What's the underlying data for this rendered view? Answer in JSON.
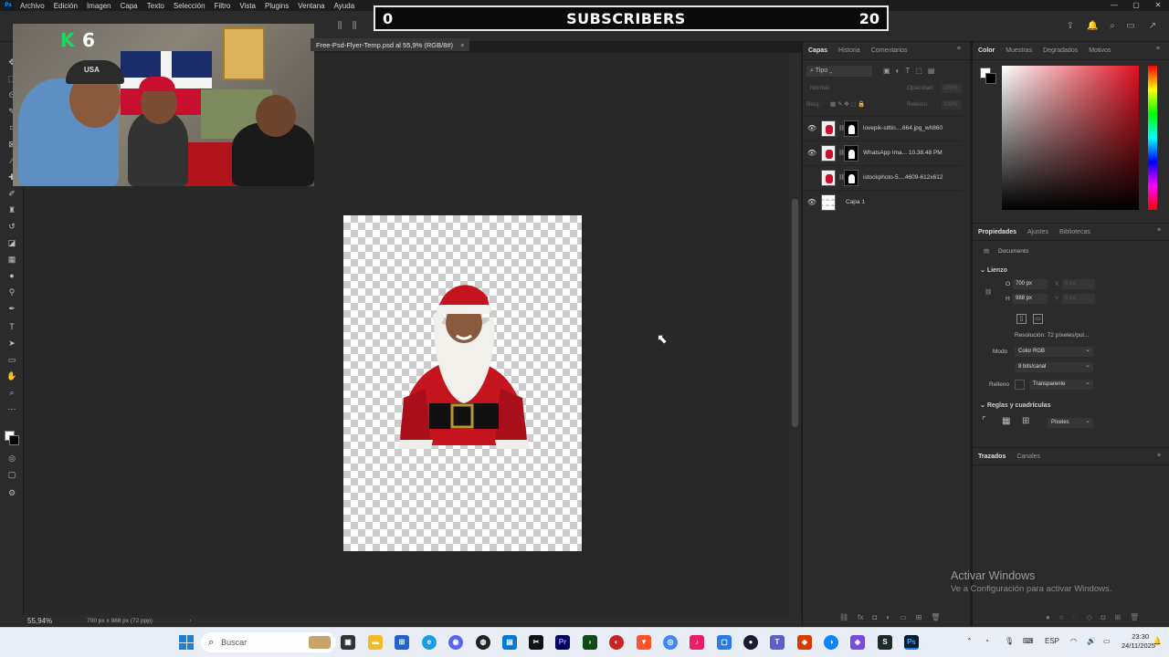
{
  "app": {
    "logo": "Ps",
    "menu": [
      "Archivo",
      "Edición",
      "Imagen",
      "Capa",
      "Texto",
      "Selección",
      "Filtro",
      "Vista",
      "Plugins",
      "Ventana",
      "Ayuda"
    ],
    "window_controls": [
      "—",
      "▢",
      "✕"
    ]
  },
  "overlay": {
    "left_count": "0",
    "title": "SUBSCRIBERS",
    "right_count": "20",
    "k_logo": "K",
    "k_number": "6",
    "cap_text": "USA"
  },
  "document": {
    "tab_title": "Free-Psd-Flyer-Temp.psd al 55,9% (RGB/8#)",
    "close_glyph": "×"
  },
  "status": {
    "zoom": "55,94%",
    "doc_info": "700 px x 988 px (72 ppp)",
    "arrow": "›"
  },
  "layers_panel": {
    "tabs": [
      "Capas",
      "Historia",
      "Comentarios"
    ],
    "filter_label": "Tipo",
    "blend_mode": "Normal",
    "opacity_label": "Opacidad:",
    "opacity_value": "100%",
    "lock_label": "Bloq.:",
    "fill_label": "Relleno:",
    "fill_value": "100%",
    "layers": [
      {
        "name": "lovepik-sittin....664.jpg_wh860",
        "visible": true
      },
      {
        "name": "WhatsApp Ima... 10.38.48 PM",
        "visible": true
      },
      {
        "name": "istockphoto-5....4609-612x612",
        "visible": false
      },
      {
        "name": "Capa 1",
        "visible": true
      }
    ]
  },
  "color_panel": {
    "tabs": [
      "Color",
      "Muestras",
      "Degradados",
      "Motivos"
    ]
  },
  "properties_panel": {
    "tabs": [
      "Propiedades",
      "Ajustes",
      "Bibliotecas"
    ],
    "doc_label": "Documento",
    "canvas_section": "Lienzo",
    "width_label": "O",
    "width_value": "700 px",
    "height_label": "H",
    "height_value": "988 px",
    "x_label": "X",
    "x_value": "0 px",
    "y_label": "Y",
    "y_value": "0 px",
    "resolution": "Resolución: 72 píxeles/pul...",
    "mode_label": "Modo",
    "mode_value": "Color RGB",
    "bits_value": "8 bits/canal",
    "fill_label": "Relleno",
    "fill_value": "Transparente",
    "rulers_section": "Reglas y cuadrículas",
    "units_value": "Píxeles"
  },
  "paths_panel": {
    "tabs": [
      "Trazados",
      "Canales"
    ]
  },
  "activation": {
    "line1": "Activar Windows",
    "line2": "Ve a Configuración para activar Windows."
  },
  "taskbar": {
    "search_placeholder": "Buscar",
    "lang": "ESP",
    "time": "23:30",
    "date": "24/11/2025"
  }
}
